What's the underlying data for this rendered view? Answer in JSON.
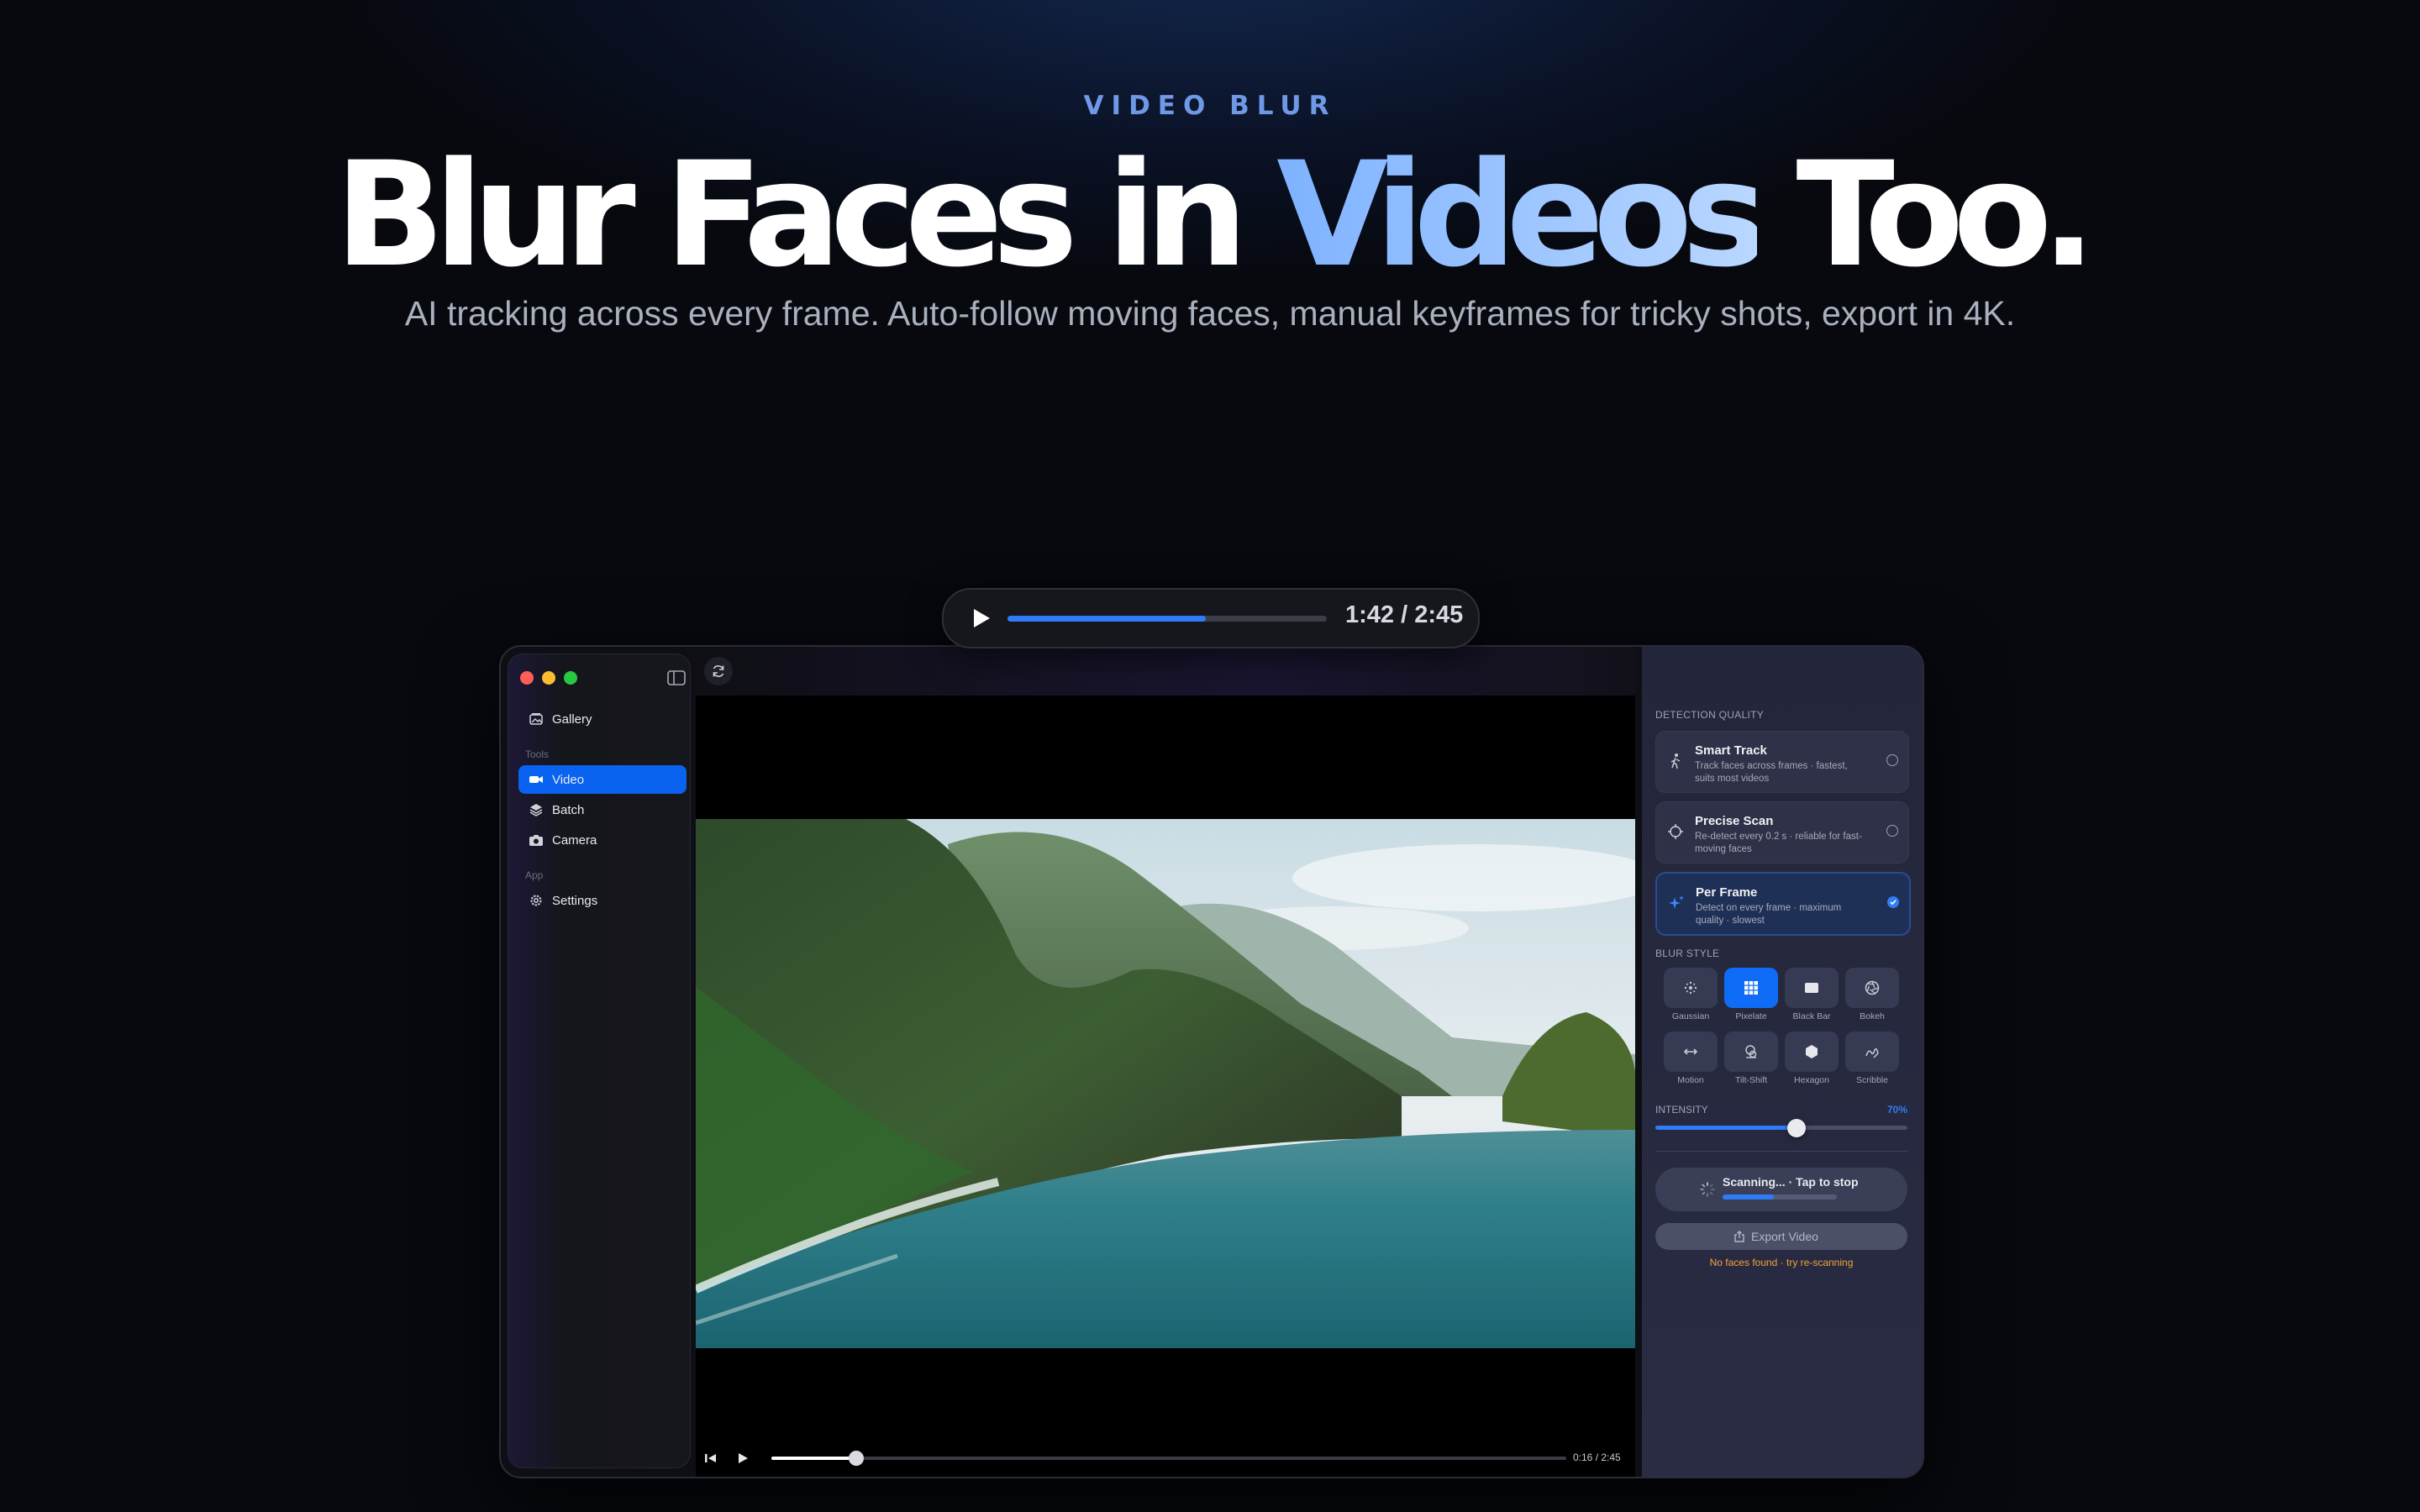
{
  "hero": {
    "eyebrow": "VIDEO BLUR",
    "title_part1": "Blur Faces in ",
    "title_accent": "Videos",
    "title_part2": " Too.",
    "subtitle": "AI tracking across every frame. Auto-follow moving faces, manual keyframes for tricky shots, export in 4K."
  },
  "player_pill": {
    "time": "1:42 / 2:45",
    "progress": 0.62
  },
  "sidebar": {
    "gallery": "Gallery",
    "tools_section": "Tools",
    "items": [
      {
        "label": "Video",
        "active": true
      },
      {
        "label": "Batch",
        "active": false
      },
      {
        "label": "Camera",
        "active": false
      }
    ],
    "app_section": "App",
    "settings": "Settings"
  },
  "video": {
    "time": "0:16 / 2:45",
    "progress": 0.107
  },
  "panel": {
    "detection_title": "DETECTION QUALITY",
    "quality_options": [
      {
        "title": "Smart Track",
        "desc": "Track faces across frames · fastest, suits most videos",
        "selected": false
      },
      {
        "title": "Precise Scan",
        "desc": "Re-detect every 0.2 s · reliable for fast-moving faces",
        "selected": false
      },
      {
        "title": "Per Frame",
        "desc": "Detect on every frame · maximum quality · slowest",
        "selected": true
      }
    ],
    "blur_title": "BLUR STYLE",
    "styles": [
      {
        "label": "Gaussian",
        "icon": "gaussian-icon",
        "active": false
      },
      {
        "label": "Pixelate",
        "icon": "pixelate-icon",
        "active": true
      },
      {
        "label": "Black Bar",
        "icon": "black-bar-icon",
        "active": false
      },
      {
        "label": "Bokeh",
        "icon": "bokeh-icon",
        "active": false
      },
      {
        "label": "Motion",
        "icon": "motion-icon",
        "active": false
      },
      {
        "label": "Tilt-Shift",
        "icon": "tilt-shift-icon",
        "active": false
      },
      {
        "label": "Hexagon",
        "icon": "hexagon-icon",
        "active": false
      },
      {
        "label": "Scribble",
        "icon": "scribble-icon",
        "active": false
      }
    ],
    "intensity_label": "INTENSITY",
    "intensity_value": "70%",
    "intensity": 0.56,
    "scan_text": "Scanning... · Tap to stop",
    "scan_progress": 0.45,
    "export_label": "Export Video",
    "warning": "No faces found · try re-scanning"
  },
  "colors": {
    "accent": "#2f7cf6",
    "warning": "#f0a43a",
    "active_nav": "#0a63f0"
  }
}
